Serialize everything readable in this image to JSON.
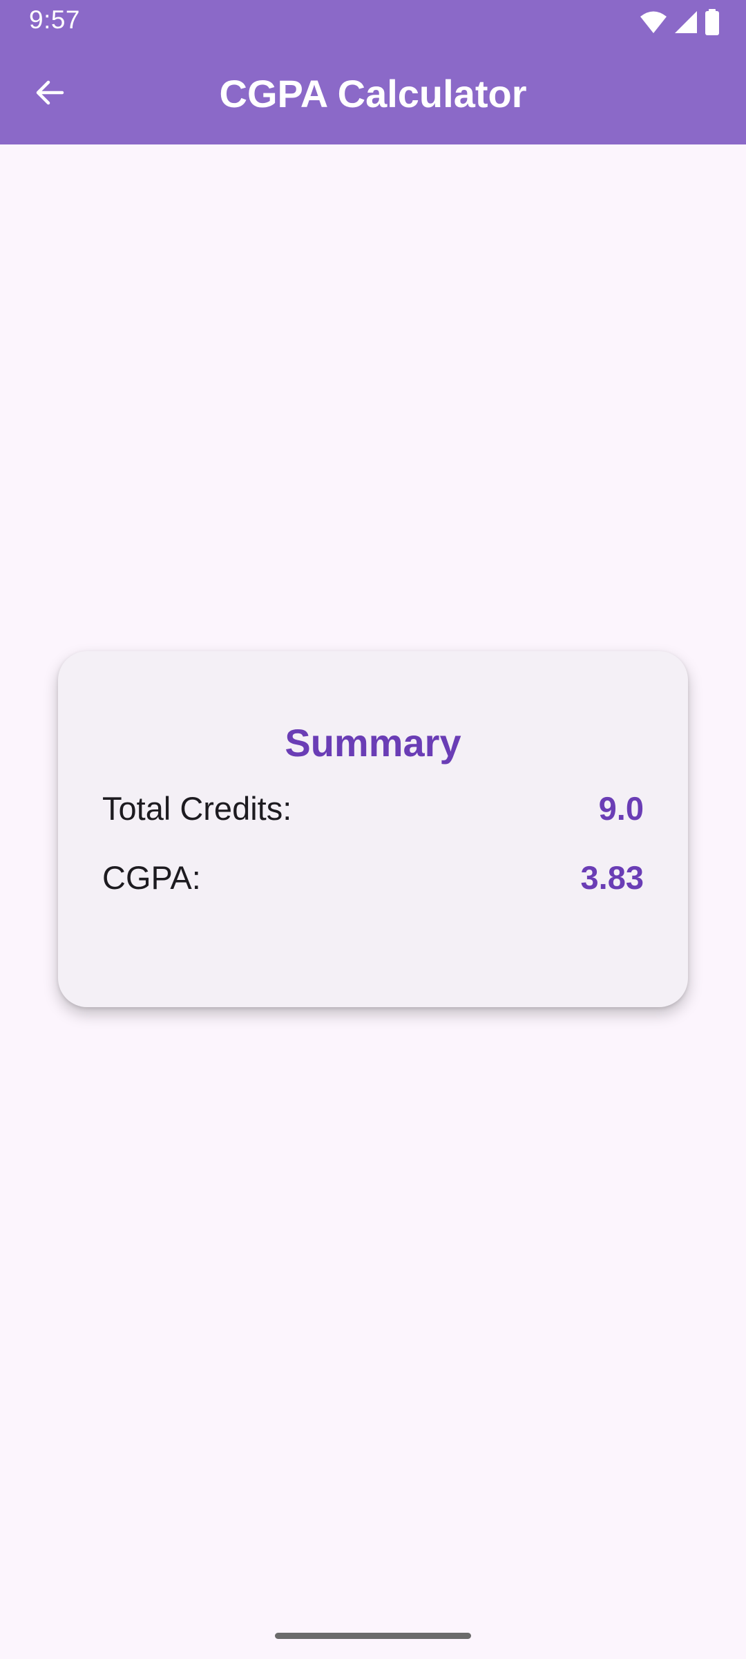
{
  "status_bar": {
    "time": "9:57",
    "icons": [
      "wifi-icon",
      "cellular-signal-icon",
      "battery-icon"
    ]
  },
  "app_bar": {
    "title": "CGPA Calculator",
    "back_icon": "arrow-back-icon"
  },
  "summary_card": {
    "title": "Summary",
    "rows": [
      {
        "label": "Total Credits:",
        "value": "9.0"
      },
      {
        "label": "CGPA:",
        "value": "3.83"
      }
    ]
  },
  "colors": {
    "app_bar": "#8b69c8",
    "accent": "#6a3db5",
    "background": "#fcf5fd",
    "card": "#f4f0f6",
    "text": "#1d1b20"
  }
}
